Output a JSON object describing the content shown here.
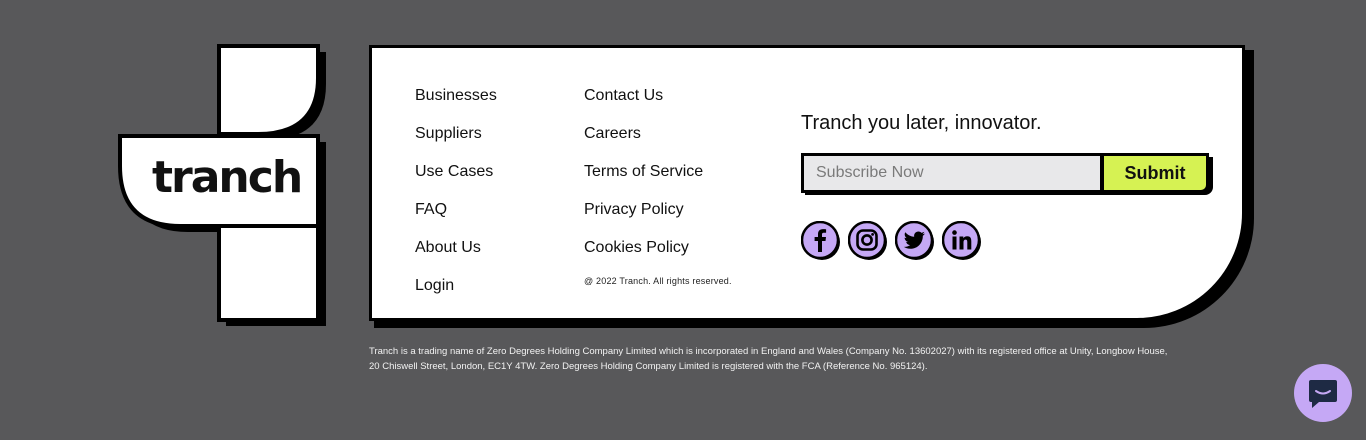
{
  "logo": {
    "text": "tranch"
  },
  "nav_col1": [
    "Businesses",
    "Suppliers",
    "Use Cases",
    "FAQ",
    "About Us",
    "Login"
  ],
  "nav_col2": [
    "Contact Us",
    "Careers",
    "Terms of Service",
    "Privacy Policy",
    "Cookies Policy"
  ],
  "copyright": "@ 2022 Tranch. All rights reserved.",
  "newsletter": {
    "tagline": "Tranch you later, innovator.",
    "placeholder": "Subscribe Now",
    "submit_label": "Submit"
  },
  "socials": [
    "facebook-icon",
    "instagram-icon",
    "twitter-icon",
    "linkedin-icon"
  ],
  "legal": {
    "line1": "Tranch is a trading name of Zero Degrees Holding Company Limited which is incorporated in England and Wales (Company No. 13602027) with its registered office at Unity, Longbow House,",
    "line2": "20 Chiswell Street, London, EC1Y 4TW. Zero Degrees Holding Company Limited is registered with the FCA (Reference No. 965124)."
  },
  "colors": {
    "background": "#58585a",
    "accent_lime": "#d6f253",
    "accent_lavender": "#c5a8f5"
  },
  "chat_icon": "chat-bubble-icon"
}
